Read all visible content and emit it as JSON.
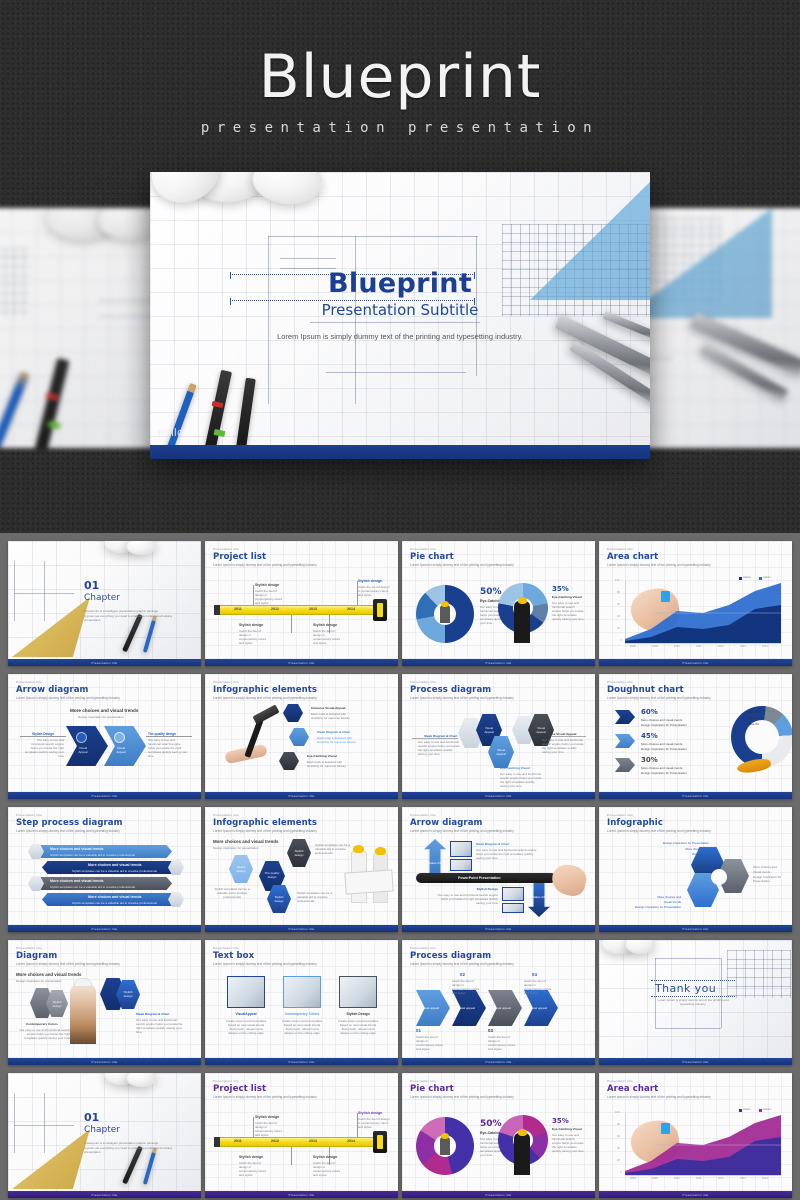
{
  "hero": {
    "title": "Blueprint",
    "subtitle": "presentation presentation",
    "slide": {
      "title": "Blueprint",
      "subtitle": "Presentation Subtitle",
      "description": "Lorem Ipsum is simply dummy text of the printing and typesetting industry.",
      "brand": "pello"
    }
  },
  "colors": {
    "page_top_bg": "#2e2e2e",
    "page_grid_bg": "#6b6b6b",
    "accent_blue": "#20459a",
    "accent_dark_blue": "#16347c",
    "accent_light_blue": "#4d8cd6",
    "accent_purple": "#5c2a9c",
    "accent_magenta": "#b12a8e",
    "tape_yellow": "#f4dc19",
    "helmet_yellow": "#f2c200"
  },
  "common": {
    "kicker": "Presentation title",
    "lede": "Lorem Ipsum is simply dummy text of the printing and typesetting industry",
    "footer": "Presentation  title",
    "body_small": "Our easy to use and functional search engine helps you locate the right templates quickly saving your time",
    "body_small2": "Each work is featured with simplicity for supreme beauty",
    "body_small3": "Stylish templates can be a valuable aid to creative professionals",
    "body_small4": "Catch the feel of design in contemporary colors and styles",
    "body_small5": "Create power pencil templates based on new visual trends that's fresh, relevant and always on the cutting edge"
  },
  "slides": [
    {
      "id": 1,
      "kind": "chapter",
      "theme": "blue",
      "number": "01",
      "title": "Chapter",
      "lines": [
        "Powerpoint is a intelligent presentation graphic package",
        "A great you everything you need to produce a professional looking presentation"
      ]
    },
    {
      "id": 2,
      "kind": "project-list",
      "theme": "blue",
      "kicker": "Presentation title",
      "title": "Project list",
      "years": [
        "2011",
        "2012",
        "2013",
        "2014"
      ],
      "callouts": [
        {
          "title": "Stylish design",
          "body": "Catch the feel of design in contemporary colors and styles"
        },
        {
          "title": "Stylish design",
          "body": "Catch the feel of design in contemporary colors and styles"
        },
        {
          "title": "Stylish design",
          "body": "Catch the feel of design in contemporary colors and styles"
        },
        {
          "title": "Stylish design",
          "body": "Catch the feel of design in contemporary colors and styles"
        }
      ]
    },
    {
      "id": 3,
      "kind": "pie",
      "theme": "blue",
      "kicker": "Presentation title",
      "title": "Pie chart",
      "donuts": [
        {
          "value": "50%",
          "label": "Eye-Catching Visual",
          "body": "Our easy to use and functional search engine helps you locate the right templates quickly saving your time"
        },
        {
          "value": "35%",
          "label": "Eye-Catching Visual",
          "body": "Our easy to use and functional search engine helps you locate the right templates quickly saving your time"
        }
      ]
    },
    {
      "id": 4,
      "kind": "area",
      "theme": "blue",
      "kicker": "Presentation title",
      "title": "Area chart",
      "legend": [
        "value1",
        "value2"
      ]
    },
    {
      "id": 5,
      "kind": "arrow-diagram",
      "theme": "blue",
      "kicker": "Presentation title",
      "title": "Arrow diagram",
      "headline": "More choices and visual trends",
      "subhead": "Design inspiration for presentation",
      "left": {
        "title": "Stylish Design",
        "chip": "Visual Appeal"
      },
      "right": {
        "title": "The quality design",
        "chip": "Visual Appeal"
      }
    },
    {
      "id": 6,
      "kind": "infographic-hammer",
      "theme": "blue",
      "kicker": "Presentation title",
      "title": "Infographic elements",
      "items": [
        {
          "title": "Immense Visual Appeal",
          "body": "Each work is featured with simplicity for supreme beauty"
        },
        {
          "title": "Sleek Diagram & Chart",
          "body": "Each work is featured with simplicity for supreme beauty"
        },
        {
          "title": "Eye-Catching Visual",
          "body": "Each work is featured with simplicity for supreme beauty"
        }
      ]
    },
    {
      "id": 7,
      "kind": "process-hex",
      "theme": "blue",
      "kicker": "Presentation title",
      "title": "Process diagram",
      "nodes": [
        {
          "label": "Visual Appeal",
          "num": "01"
        },
        {
          "label": "Visual Appeal",
          "num": "02"
        },
        {
          "label": "Visual Appeal",
          "num": "03"
        }
      ],
      "captions": [
        "Sleek Diagram & Chart",
        "Eye-Catching Visual",
        "Immense Visual Appeal"
      ]
    },
    {
      "id": 8,
      "kind": "doughnut",
      "theme": "blue",
      "kicker": "Presentation title",
      "title": "Doughnut chart",
      "rows": [
        {
          "value": "60%",
          "l1": "More choices and visual trends",
          "l2": "Design inspiration for Presentation"
        },
        {
          "value": "45%",
          "l1": "More choices and visual trends",
          "l2": "Design inspiration for Presentation"
        },
        {
          "value": "30%",
          "l1": "More choices and visual trends",
          "l2": "Design inspiration for Presentation"
        }
      ],
      "legend": [
        "Value 01",
        "Value 02",
        "Value 03"
      ],
      "center": "58745 GD"
    },
    {
      "id": 9,
      "kind": "step-process",
      "theme": "blue",
      "kicker": "Presentation title",
      "title": "Step process diagram",
      "steps": [
        {
          "num": "01",
          "title": "More choices and visual trends",
          "body": "Stylish templates can be a valuable aid to creative professionals"
        },
        {
          "num": "02",
          "title": "More choices and visual trends",
          "body": "Stylish templates can be a valuable aid to creative professionals"
        },
        {
          "num": "03",
          "title": "More choices and visual trends",
          "body": "Stylish templates can be a valuable aid to creative professionals"
        },
        {
          "num": "04",
          "title": "More choices and visual trends",
          "body": "Stylish templates can be a valuable aid to creative professionals"
        }
      ]
    },
    {
      "id": 10,
      "kind": "infographic-hex-people",
      "theme": "blue",
      "kicker": "Presentation title",
      "title": "Infographic elements",
      "headline": "More choices and visual trends",
      "subhead": "Design inspiration for presentation",
      "center": "The quality design",
      "nodes": [
        "Stylish design",
        "Stylish design",
        "Stylish design"
      ],
      "body": "Stylish templates can be a valuable aid to creative professionals"
    },
    {
      "id": 11,
      "kind": "arrow-up-down",
      "theme": "blue",
      "kicker": "Presentation title",
      "title": "Arrow diagram",
      "banner": "PowerPoint Presentation",
      "top": {
        "title": "Sleek Diagram & Chart",
        "chip": "Value 01",
        "body": "Our easy to use and functional search engine helps you locate the right templates quickly saving your time"
      },
      "bottom": {
        "title": "Stylish Design",
        "chip": "Value 02",
        "body": "Our easy to use and functional search engine helps you locate the right templates quickly saving your time"
      }
    },
    {
      "id": 12,
      "kind": "infographic-gear",
      "theme": "blue",
      "kicker": "Presentation title",
      "title": "Infographic",
      "tl": [
        "Design Inspiration for Presentation",
        "More choices and",
        "Visual trends"
      ],
      "mr": [
        "More choices and",
        "Visual trends",
        "Design Inspiration for Presentation."
      ],
      "bl": [
        "More choices and",
        "Visual trends",
        "Design Inspiration for Presentation"
      ]
    },
    {
      "id": 13,
      "kind": "diagram-woman",
      "theme": "blue",
      "kicker": "Presentation title",
      "title": "Diagram",
      "headline": "More choices and visual trends",
      "subhead": "Design inspiration for presentation",
      "left": {
        "title": "Contemporary Colors",
        "body": "Our easy to use and functional search engine helps you locate the right templates quickly saving your time",
        "chip": "Stylish design"
      },
      "right": {
        "title": "Sleek Diagram & Chart",
        "body": "Our easy to use and functional search engine helps you locate the right templates quickly saving your time",
        "chip": "Stylish design"
      }
    },
    {
      "id": 14,
      "kind": "text-box",
      "theme": "blue",
      "kicker": "Presentation title",
      "title": "Text box",
      "cards": [
        {
          "title": "VisualAppeal",
          "body": "Create power pencil templates based on new visual trends that's fresh, relevant and always on the cutting edge"
        },
        {
          "title": "Contemporary Colors",
          "body": "Create power pencil templates based on new visual trends that's fresh, relevant and always on the cutting edge"
        },
        {
          "title": "Stylish Design",
          "body": "Create power pencil templates based on new visual trends that's fresh, relevant and always on the cutting edge"
        }
      ]
    },
    {
      "id": 15,
      "kind": "process-chevron",
      "theme": "blue",
      "kicker": "Presentation title",
      "title": "Process diagram",
      "chevrons": [
        {
          "label": "Visual appeal",
          "num": "01",
          "body": "Catch the feel of design in contemporary colors and styles"
        },
        {
          "label": "Visual appeal",
          "num": "02",
          "body": "Catch the feel of design in contemporary colors and styles"
        },
        {
          "label": "Visual appeal",
          "num": "03",
          "body": "Catch the feel of design in contemporary colors and styles"
        },
        {
          "label": "Visual appeal",
          "num": "04",
          "body": "Catch the feel of design in contemporary colors and styles"
        }
      ]
    },
    {
      "id": 16,
      "kind": "thankyou",
      "theme": "blue",
      "title": "Thank you",
      "body": "Lorem Ipsum is simply dummy text of the printing and typesetting industry."
    },
    {
      "id": 17,
      "kind": "chapter",
      "theme": "purple",
      "number": "01",
      "title": "Chapter",
      "lines": [
        "Powerpoint is a intelligent presentation graphic package",
        "A great you everything you need to produce a professional looking presentation"
      ]
    },
    {
      "id": 18,
      "kind": "project-list",
      "theme": "purple",
      "kicker": "Presentation title",
      "title": "Project list",
      "years": [
        "2011",
        "2012",
        "2013",
        "2014"
      ],
      "callouts": [
        {
          "title": "Stylish design",
          "body": "Catch the feel of design in contemporary colors and styles"
        },
        {
          "title": "Stylish design",
          "body": "Catch the feel of design in contemporary colors and styles"
        },
        {
          "title": "Stylish design",
          "body": "Catch the feel of design in contemporary colors and styles"
        },
        {
          "title": "Stylish design",
          "body": "Catch the feel of design in contemporary colors and styles"
        }
      ]
    },
    {
      "id": 19,
      "kind": "pie",
      "theme": "purple",
      "kicker": "Presentation title",
      "title": "Pie chart",
      "donuts": [
        {
          "value": "50%",
          "label": "Eye-Catching Visual",
          "body": "Our easy to use and functional search engine helps you locate the right templates quickly saving your time"
        },
        {
          "value": "35%",
          "label": "Eye-Catching Visual",
          "body": "Our easy to use and functional search engine helps you locate the right templates quickly saving your time"
        }
      ]
    },
    {
      "id": 20,
      "kind": "area",
      "theme": "purple",
      "kicker": "Presentation title",
      "title": "Area chart",
      "legend": [
        "value1",
        "value2"
      ]
    }
  ],
  "chart_data": [
    {
      "type": "area",
      "title": "Area chart",
      "x": [
        "2008",
        "2009",
        "2010",
        "2011",
        "2012",
        "2013",
        "2014"
      ],
      "series": [
        {
          "name": "value1",
          "values": [
            5,
            12,
            28,
            30,
            34,
            62,
            72
          ]
        },
        {
          "name": "value2",
          "values": [
            8,
            22,
            42,
            32,
            48,
            78,
            96
          ]
        }
      ],
      "ylim": [
        0,
        100
      ],
      "yticks": [
        0,
        20,
        40,
        60,
        80,
        100
      ],
      "legend_position": "top-right",
      "grid": false
    },
    {
      "type": "pie",
      "title": "Pie chart",
      "categories": [
        "50%",
        "35%"
      ],
      "values": [
        50,
        35
      ],
      "labels": [
        "Eye-Catching Visual",
        "Eye-Catching Visual"
      ]
    },
    {
      "type": "pie",
      "title": "Doughnut chart",
      "categories": [
        "Value 01",
        "Value 02",
        "Value 03"
      ],
      "values": [
        60,
        45,
        30
      ],
      "center_label": "58745 GD"
    },
    {
      "type": "bar",
      "title": "Project list",
      "categories": [
        "2011",
        "2012",
        "2013",
        "2014"
      ],
      "values": [
        1,
        1,
        1,
        1
      ],
      "xlabel": "",
      "ylabel": ""
    }
  ]
}
